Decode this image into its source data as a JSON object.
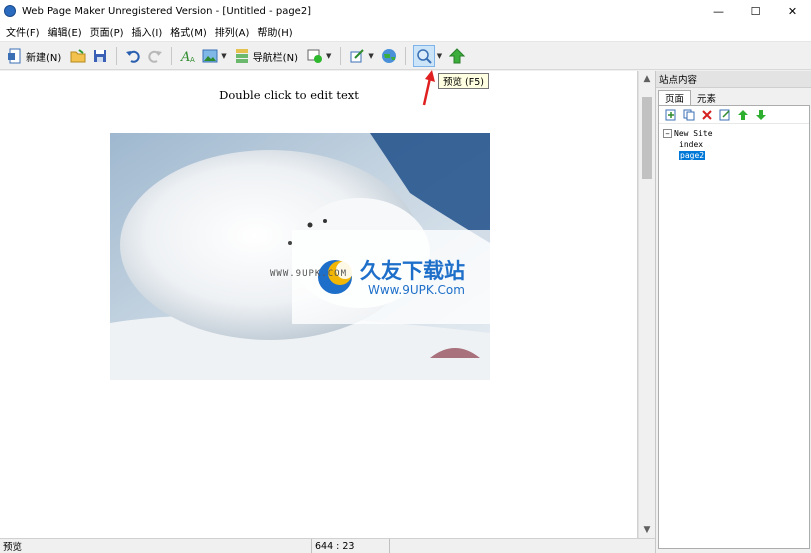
{
  "window": {
    "title": "Web Page Maker Unregistered Version - [Untitled - page2]",
    "minimize": "—",
    "maximize": "☐",
    "close": "✕"
  },
  "menu": [
    "文件(F)",
    "编辑(E)",
    "页面(P)",
    "插入(I)",
    "格式(M)",
    "排列(A)",
    "帮助(H)"
  ],
  "toolbar": {
    "new_label": "新建(N)",
    "navbar_label": "导航栏(N)",
    "tooltip": "预览 (F5)"
  },
  "editor": {
    "text": "Double click to edit text"
  },
  "photo": {
    "watermark_url": "WWW.9UPK.COM",
    "watermark_cn": "久友下载站",
    "watermark_en": "Www.9UPK.Com"
  },
  "panel": {
    "title": "站点内容",
    "tabs": [
      "页面",
      "元素"
    ],
    "tree": {
      "root": "New Site",
      "children": [
        "index",
        "page2"
      ],
      "selected": "page2"
    }
  },
  "status": {
    "left": "预览",
    "coords": "644 : 23"
  },
  "colors": {
    "accent": "#0078d7",
    "tooltip_bg": "#ffffe1",
    "arrow": "#e02020"
  }
}
